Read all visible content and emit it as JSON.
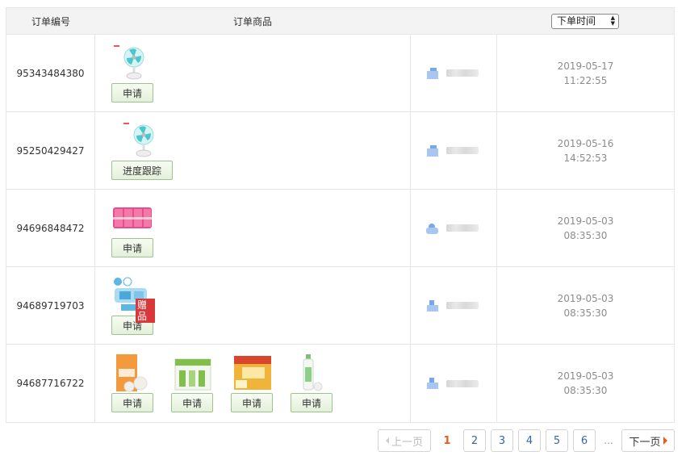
{
  "header": {
    "order_number": "订单编号",
    "order_goods": "订单商品",
    "time_select": "下单时间"
  },
  "orders": [
    {
      "id": "95343484380",
      "date": "2019-05-17",
      "time": "11:22:55",
      "items": [
        {
          "product": "fan-product",
          "button": "申请"
        }
      ]
    },
    {
      "id": "95250429427",
      "date": "2019-05-16",
      "time": "14:52:53",
      "items": [
        {
          "product": "fan-product",
          "button": "进度跟踪"
        }
      ]
    },
    {
      "id": "94696848472",
      "date": "2019-05-03",
      "time": "08:35:30",
      "items": [
        {
          "product": "pink-packs-product",
          "button": "申请"
        }
      ]
    },
    {
      "id": "94689719703",
      "date": "2019-05-03",
      "time": "08:35:30",
      "items": [
        {
          "product": "blue-gift-product",
          "button": "申请",
          "tag": "赠品"
        }
      ]
    },
    {
      "id": "94687716722",
      "date": "2019-05-03",
      "time": "08:35:30",
      "items": [
        {
          "product": "orange-tissue-product",
          "button": "申请"
        },
        {
          "product": "green-box-product",
          "button": "申请"
        },
        {
          "product": "yellow-box-product",
          "button": "申请"
        },
        {
          "product": "bottle-product",
          "button": "申请"
        }
      ]
    }
  ],
  "pagination": {
    "prev": "上一页",
    "pages": [
      "1",
      "2",
      "3",
      "4",
      "5",
      "6"
    ],
    "current": "1",
    "ellipsis": "...",
    "next": "下一页"
  },
  "colors": {
    "button_border": "#9fc28e",
    "gift_tag": "#d9383a",
    "current_page": "#e85b1a",
    "link": "#3866a5"
  }
}
